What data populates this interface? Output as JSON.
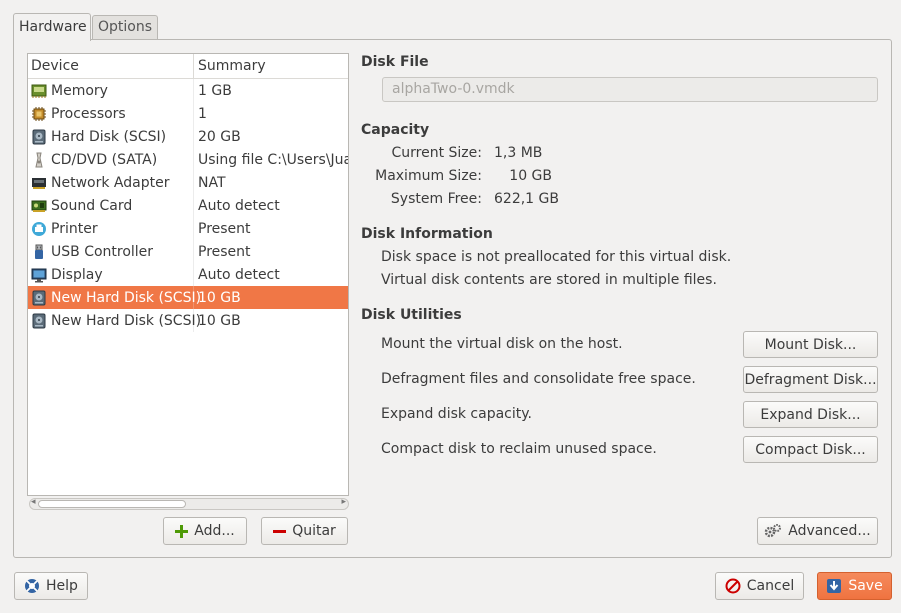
{
  "tabs": [
    "Hardware",
    "Options"
  ],
  "device_list": {
    "columns": [
      "Device",
      "Summary"
    ],
    "rows": [
      {
        "device": "Memory",
        "summary": "1 GB",
        "icon": "memory-icon"
      },
      {
        "device": "Processors",
        "summary": "1",
        "icon": "processor-icon"
      },
      {
        "device": "Hard Disk (SCSI)",
        "summary": "20 GB",
        "icon": "hard-disk-icon"
      },
      {
        "device": "CD/DVD (SATA)",
        "summary": "Using file C:\\Users\\Jua",
        "icon": "cd-dvd-icon"
      },
      {
        "device": "Network Adapter",
        "summary": "NAT",
        "icon": "network-adapter-icon"
      },
      {
        "device": "Sound Card",
        "summary": "Auto detect",
        "icon": "sound-card-icon"
      },
      {
        "device": "Printer",
        "summary": "Present",
        "icon": "printer-icon"
      },
      {
        "device": "USB Controller",
        "summary": "Present",
        "icon": "usb-icon"
      },
      {
        "device": "Display",
        "summary": "Auto detect",
        "icon": "display-icon"
      },
      {
        "device": "New Hard Disk (SCSI)",
        "summary": "10 GB",
        "icon": "hard-disk-icon",
        "selected": true
      },
      {
        "device": "New Hard Disk (SCSI)",
        "summary": "10 GB",
        "icon": "hard-disk-icon"
      }
    ]
  },
  "list_buttons": {
    "add": "Add...",
    "remove": "Quitar"
  },
  "disk_file": {
    "heading": "Disk File",
    "value": "alphaTwo-0.vmdk"
  },
  "capacity": {
    "heading": "Capacity",
    "current_label": "Current Size:",
    "current_value": "1,3 MB",
    "max_label": "Maximum Size:",
    "max_value": "10 GB",
    "free_label": "System Free:",
    "free_value": "622,1 GB"
  },
  "disk_info": {
    "heading": "Disk Information",
    "line1": "Disk space is not preallocated for this virtual disk.",
    "line2": "Virtual disk contents are stored in multiple files."
  },
  "disk_utilities": {
    "heading": "Disk Utilities",
    "items": [
      {
        "text": "Mount the virtual disk on the host.",
        "button": "Mount Disk..."
      },
      {
        "text": "Defragment files and consolidate free space.",
        "button": "Defragment Disk..."
      },
      {
        "text": "Expand disk capacity.",
        "button": "Expand Disk..."
      },
      {
        "text": "Compact disk to reclaim unused space.",
        "button": "Compact Disk..."
      }
    ]
  },
  "advanced_button": "Advanced...",
  "footer": {
    "help": "Help",
    "cancel": "Cancel",
    "save": "Save"
  },
  "colors": {
    "selection": "#f07746",
    "save_button": "#f07746"
  }
}
